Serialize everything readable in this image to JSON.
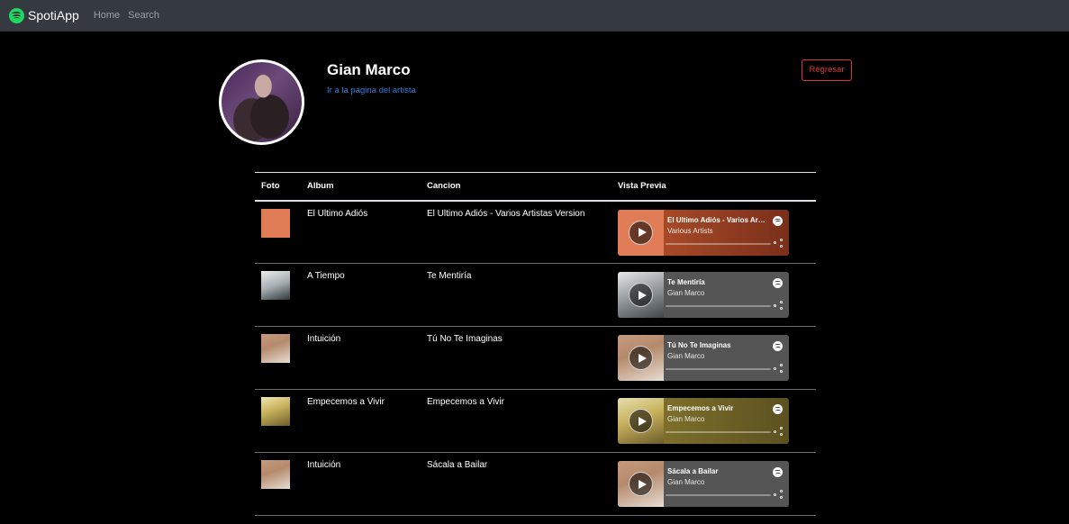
{
  "navbar": {
    "brand": "SpotiApp",
    "links": [
      "Home",
      "Search"
    ]
  },
  "artist": {
    "name": "Gian Marco",
    "link_text": "Ir a la pagina del artista",
    "back_button": "Regresar"
  },
  "table": {
    "headers": [
      "Foto",
      "Album",
      "Cancion",
      "Vista Previa"
    ],
    "rows": [
      {
        "album": "El Ultimo Adiós",
        "song": "El Ultimo Adiós - Varios Artistas Version",
        "preview_title": "El Ultimo Adiós - Varios Artistas Version",
        "preview_artist": "Various Artists"
      },
      {
        "album": "A Tiempo",
        "song": "Te Mentiría",
        "preview_title": "Te Mentiría",
        "preview_artist": "Gian Marco"
      },
      {
        "album": "Intuición",
        "song": "Tú No Te Imaginas",
        "preview_title": "Tú No Te Imaginas",
        "preview_artist": "Gian Marco"
      },
      {
        "album": "Empecemos a Vivir",
        "song": "Empecemos a Vivir",
        "preview_title": "Empecemos a Vivir",
        "preview_artist": "Gian Marco"
      },
      {
        "album": "Intuición",
        "song": "Sácala a Bailar",
        "preview_title": "Sácala a Bailar",
        "preview_artist": "Gian Marco"
      }
    ]
  },
  "colors": {
    "navbar_bg": "#343a40",
    "link_blue": "#2e7bdc",
    "danger_red": "#d9383c",
    "spotify_green": "#1ed760"
  },
  "icons": [
    "spotify-logo-icon",
    "play-icon",
    "spotify-icon",
    "share-icon"
  ]
}
